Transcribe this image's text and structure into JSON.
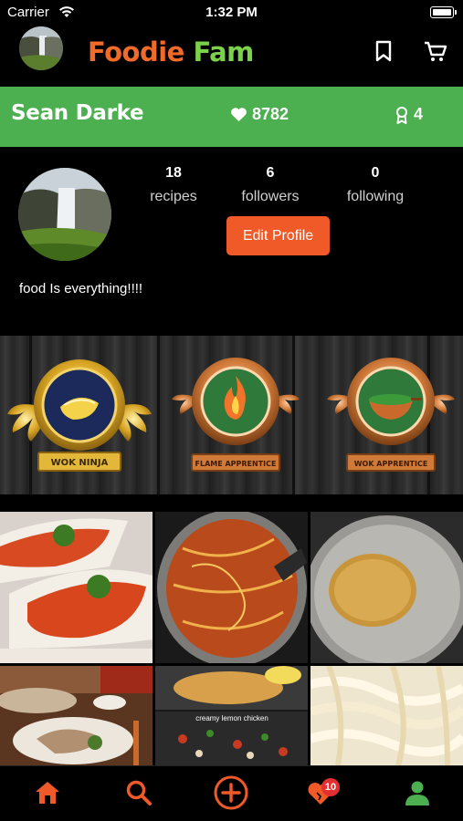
{
  "status_bar": {
    "carrier": "Carrier",
    "time": "1:32 PM"
  },
  "header": {
    "title_part1": "Foodie",
    "title_part2": "Fam",
    "bookmark_icon": "bookmark-icon",
    "cart_icon": "cart-icon"
  },
  "banner": {
    "name": "Sean Darke",
    "likes": "8782",
    "awards": "4",
    "color": "#4caf50"
  },
  "profile": {
    "stats": [
      {
        "value": "18",
        "label": "recipes"
      },
      {
        "value": "6",
        "label": "followers"
      },
      {
        "value": "0",
        "label": "following"
      }
    ],
    "edit_button": "Edit Profile",
    "bio": "food Is everything!!!!"
  },
  "badges": [
    {
      "label": "WOK NINJA",
      "tier": "gold"
    },
    {
      "label": "FLAME APPRENTICE",
      "tier": "bronze"
    },
    {
      "label": "WOK APPRENTICE",
      "tier": "bronze"
    }
  ],
  "grid": {
    "photo_caption": "creamy lemon chicken"
  },
  "bottom_nav": {
    "items": [
      "home-icon",
      "search-icon",
      "add-icon",
      "favorites-icon",
      "profile-icon"
    ],
    "notification_count": "10",
    "accent": "#f05a28",
    "active_color": "#4caf50"
  }
}
